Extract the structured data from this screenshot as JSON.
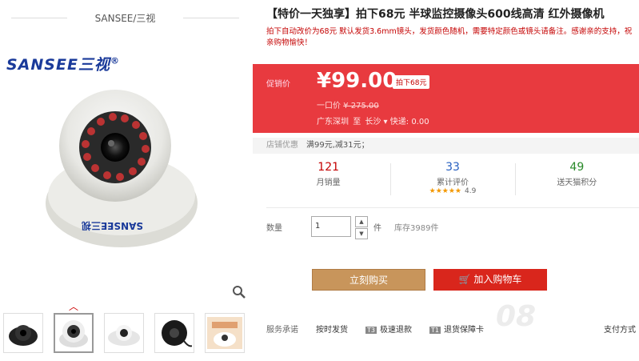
{
  "shop": {
    "name": "SANSEE/三视",
    "brand_logo": "SANSEE三视",
    "reg": "®"
  },
  "thumbs": [
    "thumb-1",
    "thumb-2",
    "thumb-3",
    "thumb-4",
    "thumb-5"
  ],
  "product": {
    "title": "【特价一天独享】拍下68元 半球监控摄像头600线高清 红外摄像机",
    "subtitle": "拍下自动改价为68元 默认发货3.6mm镜头，发货颜色随机，需要特定颜色或镜头请备注。感谢亲的支持，祝亲购物愉快！"
  },
  "price": {
    "label": "促销价",
    "value": "¥99.00",
    "badge": "拍下68元",
    "orig_label": "一口价",
    "orig_value": "¥ 275.00",
    "from": "广东深圳",
    "to_label": "至",
    "to": "长沙",
    "shipping": "快递: 0.00"
  },
  "promo": {
    "label": "店铺优惠",
    "text": "满99元,减31元；"
  },
  "stats": {
    "sales": {
      "num": "121",
      "label": "月销量"
    },
    "reviews": {
      "num": "33",
      "label": "累计评价",
      "rating": "4.9",
      "stars": "★★★★★"
    },
    "points": {
      "num": "49",
      "label": "送天猫积分"
    }
  },
  "qty": {
    "label": "数量",
    "value": "1",
    "unit": "件",
    "stock": "库存3989件"
  },
  "buttons": {
    "buy": "立刻购买",
    "cart": "加入购物车"
  },
  "services": {
    "label": "服务承诺",
    "items": [
      "按时发货",
      "极速退款",
      "退货保障卡"
    ],
    "tags": [
      "T3",
      "T1"
    ],
    "pay": "支付方式"
  },
  "watermark": "08"
}
